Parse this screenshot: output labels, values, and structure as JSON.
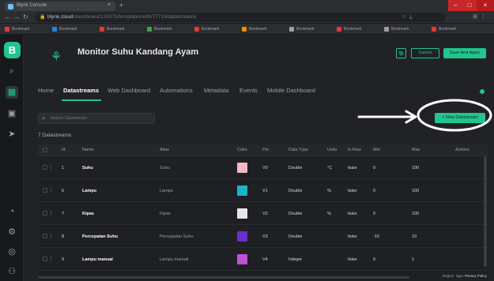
{
  "browser": {
    "tab_title": "Blynk Console",
    "url_host": "blynk.cloud",
    "url_path": "/dashboard/120575/templates/edit/77719/datastreams",
    "bookmarks": [
      "Bookmark",
      "Bookmark",
      "Bookmark",
      "Bookmark",
      "Bookmark",
      "Bookmark",
      "Bookmark",
      "Bookmark",
      "Bookmark",
      "Bookmark"
    ]
  },
  "app": {
    "logo": "B"
  },
  "header": {
    "title": "Monitor Suhu Kandang Ayam",
    "cancel": "Cancel",
    "save": "Save And Apply"
  },
  "tabs": [
    "Home",
    "Datastreams",
    "Web Dashboard",
    "Automations",
    "Metadata",
    "Events",
    "Mobile Dashboard"
  ],
  "toolbar": {
    "search_placeholder": "Search Datastream",
    "new_button": "+ New Datastream",
    "count": "7 Datastreams"
  },
  "table": {
    "columns": [
      "Id",
      "Name",
      "Alias",
      "Color",
      "Pin",
      "Data Type",
      "Units",
      "Is Raw",
      "Min",
      "Max",
      "Actions"
    ],
    "rows": [
      {
        "id": "1",
        "name": "Suhu",
        "alias": "Suhu",
        "color": "#f4b9c2",
        "pin": "V0",
        "type": "Double",
        "units": "°C",
        "raw": "false",
        "min": "0",
        "max": "100"
      },
      {
        "id": "6",
        "name": "Lampu",
        "alias": "Lampu",
        "color": "#19b6c8",
        "pin": "V1",
        "type": "Double",
        "units": "%",
        "raw": "false",
        "min": "0",
        "max": "100"
      },
      {
        "id": "7",
        "name": "Kipas",
        "alias": "Kipas",
        "color": "#e6e6e6",
        "pin": "V2",
        "type": "Double",
        "units": "%",
        "raw": "false",
        "min": "0",
        "max": "100"
      },
      {
        "id": "8",
        "name": "Percepatan Suhu",
        "alias": "Percepatan Suhu",
        "color": "#6a2fd1",
        "pin": "V3",
        "type": "Double",
        "units": "",
        "raw": "false",
        "min": "-10",
        "max": "10"
      },
      {
        "id": "9",
        "name": "Lampu manual",
        "alias": "Lampu manual",
        "color": "#c050d6",
        "pin": "V4",
        "type": "Integer",
        "units": "",
        "raw": "false",
        "min": "0",
        "max": "1"
      }
    ]
  },
  "footer": {
    "region": "Region: sgp1",
    "policy": "Privacy Policy"
  },
  "colors": {
    "accent": "#23c48e",
    "bg": "#202226",
    "annotation": "#ffffff"
  },
  "icons": [
    "search-icon",
    "memory-chip-icon",
    "grid-icon",
    "briefcase-icon",
    "send-icon",
    "wifi-icon",
    "gear-icon",
    "settings-icon",
    "user-icon",
    "device-icon"
  ]
}
